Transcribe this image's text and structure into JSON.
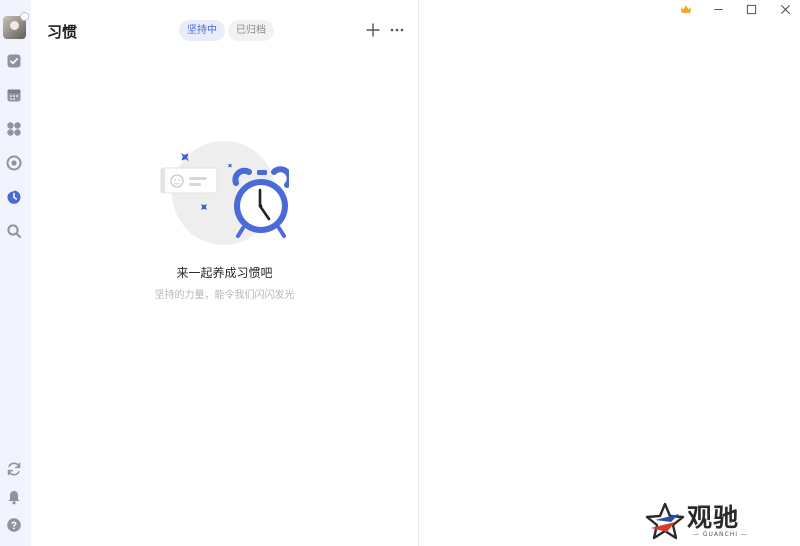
{
  "sidebar": {
    "items": [
      {
        "name": "avatar"
      },
      {
        "icon": "checkbox-icon"
      },
      {
        "icon": "calendar-icon"
      },
      {
        "icon": "grid-icon"
      },
      {
        "icon": "focus-icon"
      },
      {
        "icon": "habit-icon",
        "active": true
      },
      {
        "icon": "search-icon"
      },
      {
        "icon": "sync-icon"
      },
      {
        "icon": "bell-icon"
      },
      {
        "icon": "help-icon"
      }
    ]
  },
  "header": {
    "title": "习惯",
    "tabs": [
      {
        "label": "坚持中",
        "active": true
      },
      {
        "label": "已归档",
        "active": false
      }
    ]
  },
  "empty_state": {
    "title": "来一起养成习惯吧",
    "subtitle": "坚持的力量，能令我们闪闪发光"
  },
  "window_controls": [
    "crown-icon",
    "minimize-icon",
    "maximize-icon",
    "close-icon"
  ],
  "watermark": {
    "text": "观驰",
    "subtext": "— GUANCHI —"
  },
  "colors": {
    "accent": "#4a6ad8",
    "rail_bg": "#f2f3fc",
    "icon_gray": "#8e93a1",
    "crown": "#f5a623"
  }
}
